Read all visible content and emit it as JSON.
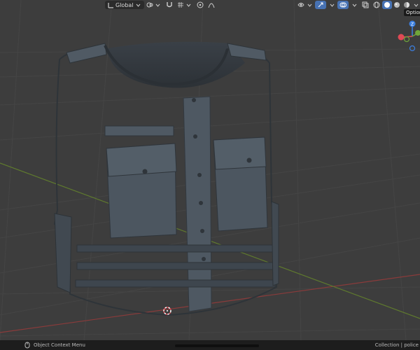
{
  "header": {
    "transform_orientation": "Global",
    "options_tooltip": "Options"
  },
  "statusbar": {
    "left_hint": "Object Context Menu",
    "right_text": "Collection | police"
  },
  "gizmo": {
    "z_label": "Z",
    "x_color": "#e04a55",
    "y_color": "#6fa53a",
    "z_color": "#3c7fe0"
  },
  "colors": {
    "viewport_bg": "#3d3d3d",
    "grid_line": "#474747",
    "axis_red": "#8a3b3b",
    "axis_green": "#5f7a2e",
    "vest": "#47505a",
    "accent": "#4772b3"
  },
  "icons": {
    "transform_orientation": "axes-icon",
    "pivot": "pivot-icon",
    "snap": "magnet-icon",
    "proportional": "proportional-edit-icon",
    "falloff": "falloff-curve-icon",
    "visibility": "eye-dropdown-icon",
    "gizmo_toggle": "gizmo-icon",
    "overlays": "overlays-icon",
    "xray": "xray-icon",
    "shading_wire": "wireframe-shading-icon",
    "shading_solid": "solid-shading-icon",
    "shading_material": "material-shading-icon",
    "shading_render": "render-shading-icon",
    "cursor_3d": "3d-cursor-icon",
    "mouse": "mouse-icon"
  }
}
